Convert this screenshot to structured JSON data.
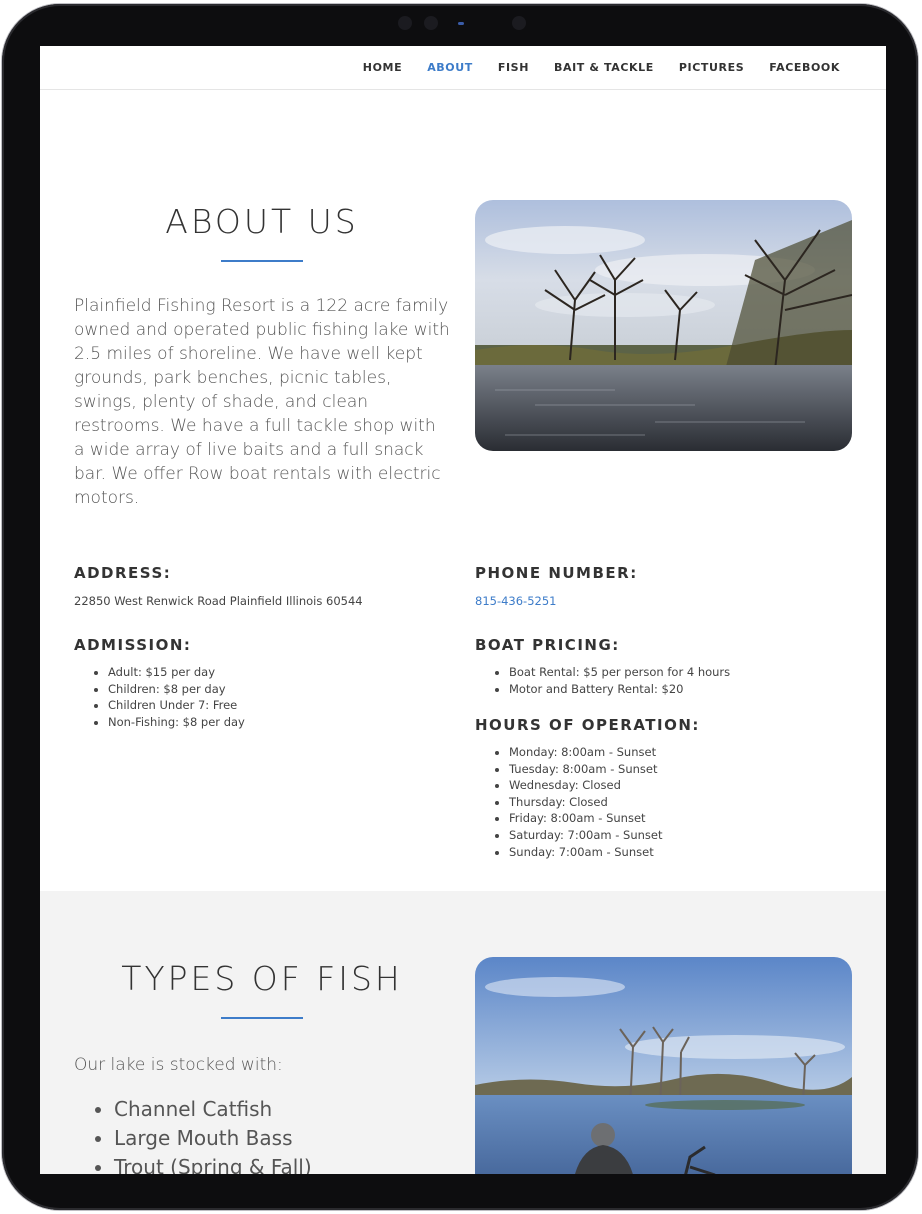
{
  "nav": {
    "items": [
      {
        "label": "HOME",
        "active": false
      },
      {
        "label": "ABOUT",
        "active": true
      },
      {
        "label": "FISH",
        "active": false
      },
      {
        "label": "BAIT & TACKLE",
        "active": false
      },
      {
        "label": "PICTURES",
        "active": false
      },
      {
        "label": "FACEBOOK",
        "active": false
      }
    ]
  },
  "about": {
    "title": "ABOUT US",
    "text": "Plainfield Fishing Resort is a 122 acre family owned and operated public fishing lake with 2.5 miles of shoreline. We have well kept grounds, park benches, picnic tables, swings, plenty of shade, and clean restrooms. We have a full tackle shop with a wide array of live baits and a full snack bar. We offer Row boat rentals with electric motors."
  },
  "address": {
    "heading": "ADDRESS:",
    "value": "22850 West Renwick Road Plainfield Illinois 60544"
  },
  "phone": {
    "heading": "PHONE NUMBER:",
    "value": "815-436-5251"
  },
  "admission": {
    "heading": "ADMISSION:",
    "items": [
      "Adult: $15 per day",
      "Children: $8 per day",
      "Children Under 7: Free",
      "Non-Fishing: $8 per day"
    ]
  },
  "boat": {
    "heading": "BOAT PRICING:",
    "items": [
      "Boat Rental: $5 per person for 4 hours",
      "Motor and Battery Rental: $20"
    ]
  },
  "hours": {
    "heading": "HOURS OF OPERATION:",
    "items": [
      "Monday: 8:00am - Sunset",
      "Tuesday: 8:00am - Sunset",
      "Wednesday: Closed",
      "Thursday: Closed",
      "Friday: 8:00am - Sunset",
      "Saturday: 7:00am - Sunset",
      "Sunday: 7:00am - Sunset"
    ]
  },
  "fish": {
    "title": "TYPES OF FISH",
    "intro": "Our lake is stocked with:",
    "items": [
      "Channel Catfish",
      "Large Mouth Bass",
      "Trout (Spring & Fall)"
    ]
  },
  "colors": {
    "accent": "#3d7cc9",
    "text": "#333333",
    "section_gray": "#f3f3f3"
  }
}
